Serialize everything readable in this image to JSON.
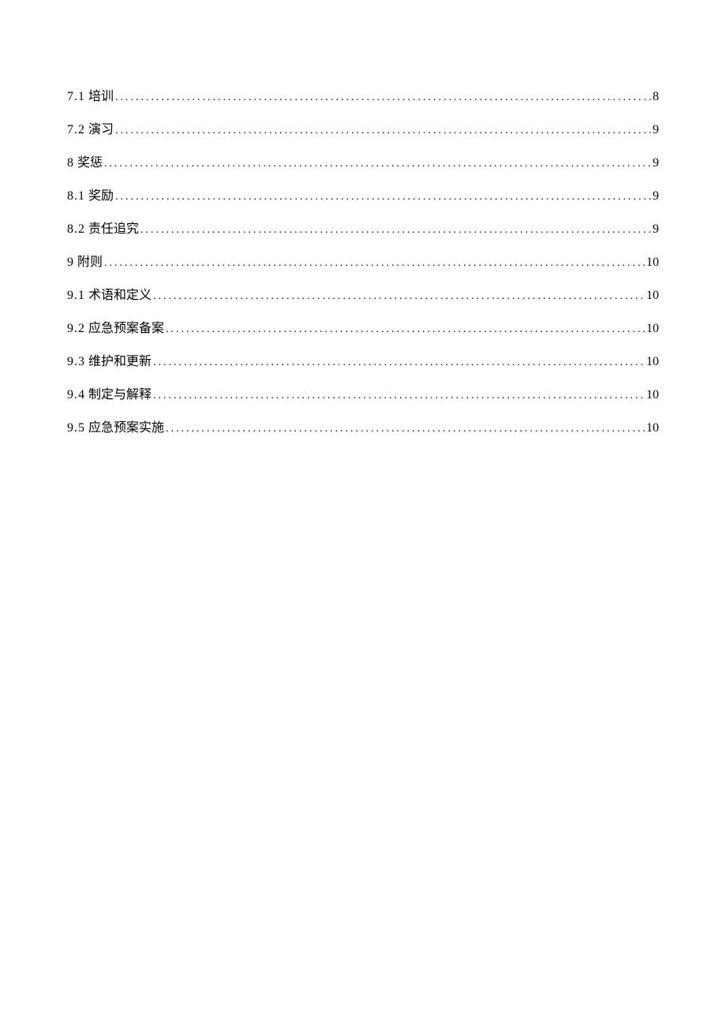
{
  "toc": [
    {
      "num": "7.1",
      "title": "培训",
      "page": "8"
    },
    {
      "num": "7.2",
      "title": "演习",
      "page": "9"
    },
    {
      "num": "8",
      "title": "奖惩",
      "page": "9"
    },
    {
      "num": "8.1",
      "title": "奖励",
      "page": "9"
    },
    {
      "num": "8.2",
      "title": "责任追究",
      "page": "9"
    },
    {
      "num": "9",
      "title": "附则",
      "page": "10"
    },
    {
      "num": "9.1",
      "title": "术语和定义",
      "page": "10"
    },
    {
      "num": "9.2",
      "title": "应急预案备案",
      "page": "10"
    },
    {
      "num": "9.3",
      "title": "维护和更新",
      "page": "10"
    },
    {
      "num": "9.4",
      "title": "制定与解释",
      "page": "10"
    },
    {
      "num": "9.5",
      "title": "应急预案实施",
      "page": "10"
    }
  ]
}
